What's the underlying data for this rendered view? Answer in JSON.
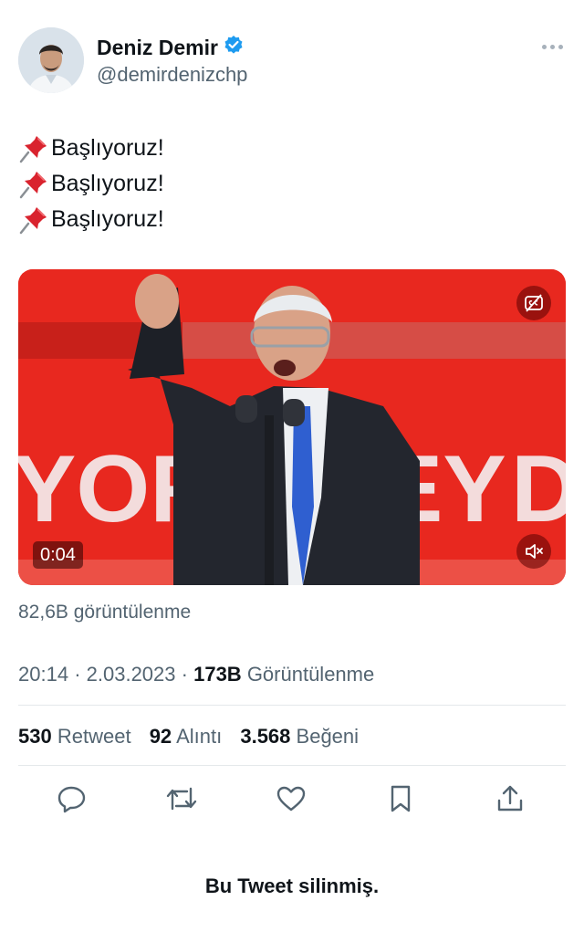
{
  "author": {
    "display_name": "Deniz Demir",
    "handle": "@demirdenizchp",
    "verified": true
  },
  "tweet": {
    "lines": [
      {
        "emoji": "pushpin-icon",
        "text": "Başlıyoruz!"
      },
      {
        "emoji": "pushpin-icon",
        "text": "Başlıyoruz!"
      },
      {
        "emoji": "pushpin-icon",
        "text": "Başlıyoruz!"
      }
    ]
  },
  "media": {
    "duration": "0:04",
    "background_color": "#e8281f"
  },
  "video_views": "82,6B görüntülenme",
  "meta": {
    "time": "20:14",
    "date": "2.03.2023",
    "separator": "·",
    "views_count": "173B",
    "views_label": "Görüntülenme"
  },
  "stats": {
    "retweets_count": "530",
    "retweets_label": "Retweet",
    "quotes_count": "92",
    "quotes_label": "Alıntı",
    "likes_count": "3.568",
    "likes_label": "Beğeni"
  },
  "actions": [
    "reply-icon",
    "retweet-icon",
    "like-icon",
    "bookmark-icon",
    "share-icon"
  ],
  "deleted_notice": "Bu Tweet silinmiş.",
  "colors": {
    "verified_blue": "#1d9bf0",
    "secondary_text": "#536471",
    "primary_text": "#0f1419"
  }
}
